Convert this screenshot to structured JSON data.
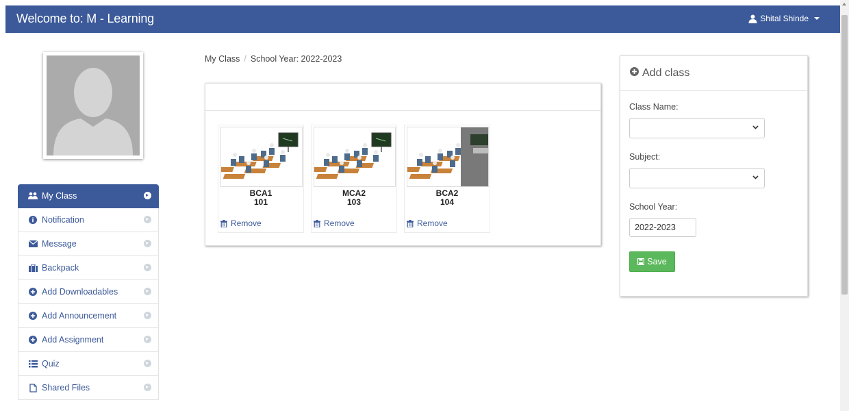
{
  "navbar": {
    "brand": "Welcome to: M - Learning",
    "user_name": "Shital Shinde",
    "user_icon": "user-icon"
  },
  "sidebar": {
    "items": [
      {
        "label": "My Class",
        "icon": "users-icon",
        "active": true
      },
      {
        "label": "Notification",
        "icon": "info-circle-icon"
      },
      {
        "label": "Message",
        "icon": "envelope-icon"
      },
      {
        "label": "Backpack",
        "icon": "briefcase-icon"
      },
      {
        "label": "Add Downloadables",
        "icon": "plus-circle-icon"
      },
      {
        "label": "Add Announcement",
        "icon": "plus-circle-icon"
      },
      {
        "label": "Add Assignment",
        "icon": "plus-circle-icon"
      },
      {
        "label": "Quiz",
        "icon": "list-icon"
      },
      {
        "label": "Shared Files",
        "icon": "file-icon"
      }
    ]
  },
  "breadcrumb": {
    "home": "My Class",
    "current": "School Year: 2022-2023"
  },
  "classes": [
    {
      "name": "BCA1",
      "code": "101",
      "remove_label": "Remove"
    },
    {
      "name": "MCA2",
      "code": "103",
      "remove_label": "Remove"
    },
    {
      "name": "BCA2",
      "code": "104",
      "remove_label": "Remove"
    }
  ],
  "add_class": {
    "title": "Add class",
    "class_name_label": "Class Name:",
    "class_name_value": "",
    "subject_label": "Subject:",
    "subject_value": "",
    "school_year_label": "School Year:",
    "school_year_value": "2022-2023",
    "save_label": "Save"
  },
  "colors": {
    "brand": "#3c5a9a",
    "success": "#5cb85c"
  }
}
